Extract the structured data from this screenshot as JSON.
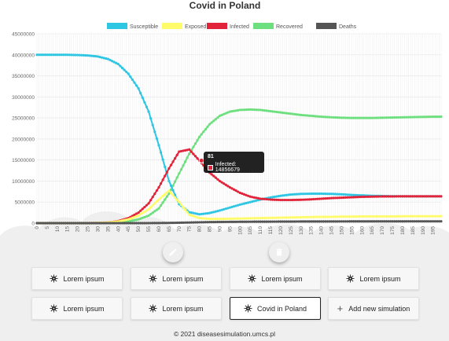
{
  "colors": {
    "susceptible": "#2ec6e3",
    "exposed": "#fffb6a",
    "infected": "#e2243b",
    "recovered": "#6ddf7e",
    "deaths": "#555555",
    "edit_fab": "#3f51b5",
    "delete_fab": "#f44336"
  },
  "chart_data": {
    "type": "line",
    "title": "Covid in Poland",
    "x": [
      0,
      5,
      10,
      15,
      20,
      25,
      30,
      35,
      40,
      45,
      50,
      55,
      60,
      65,
      70,
      75,
      80,
      85,
      90,
      95,
      100,
      105,
      110,
      115,
      120,
      125,
      130,
      135,
      140,
      145,
      150,
      155,
      160,
      165,
      170,
      175,
      180,
      185,
      190,
      195
    ],
    "x_ticks": [
      "0",
      "5",
      "10",
      "15",
      "20",
      "25",
      "30",
      "35",
      "40",
      "45",
      "50",
      "55",
      "60",
      "65",
      "70",
      "75",
      "80",
      "85",
      "90",
      "95",
      "100",
      "105",
      "110",
      "115",
      "120",
      "125",
      "130",
      "135",
      "140",
      "145",
      "150",
      "155",
      "160",
      "165",
      "170",
      "175",
      "180",
      "185",
      "190",
      "195"
    ],
    "y_ticks": [
      "0",
      "5000000",
      "10000000",
      "15000000",
      "20000000",
      "25000000",
      "30000000",
      "35000000",
      "40000000",
      "45000000"
    ],
    "ylim": [
      0,
      45000000
    ],
    "xlim": [
      0,
      199
    ],
    "grid": true,
    "legend_position": "top",
    "series": [
      {
        "name": "Susceptible",
        "color_key": "susceptible",
        "values": [
          40000000,
          40000000,
          40000000,
          40000000,
          39950000,
          39850000,
          39600000,
          39000000,
          37800000,
          35500000,
          32000000,
          26500000,
          18500000,
          10000000,
          4500000,
          2600000,
          2100000,
          2400000,
          3000000,
          3700000,
          4400000,
          5000000,
          5600000,
          6100000,
          6500000,
          6800000,
          6950000,
          7000000,
          7000000,
          6950000,
          6850000,
          6700000,
          6600000,
          6500000,
          6450000,
          6400000,
          6380000,
          6370000,
          6370000,
          6370000
        ]
      },
      {
        "name": "Exposed",
        "color_key": "exposed",
        "values": [
          0,
          0,
          0,
          0,
          0,
          0,
          50000,
          150000,
          400000,
          900000,
          1800000,
          3300000,
          5600000,
          7700000,
          5000000,
          2000000,
          1200000,
          1000000,
          1000000,
          1050000,
          1100000,
          1150000,
          1200000,
          1250000,
          1300000,
          1350000,
          1400000,
          1450000,
          1500000,
          1500000,
          1550000,
          1550000,
          1600000,
          1600000,
          1600000,
          1600000,
          1650000,
          1650000,
          1650000,
          1650000
        ]
      },
      {
        "name": "Infected",
        "color_key": "infected",
        "values": [
          0,
          0,
          0,
          0,
          0,
          0,
          50000,
          150000,
          500000,
          1200000,
          2500000,
          4700000,
          8500000,
          13000000,
          17000000,
          17500000,
          14856679,
          12000000,
          10000000,
          8500000,
          7200000,
          6300000,
          5800000,
          5600000,
          5500000,
          5500000,
          5550000,
          5650000,
          5800000,
          5950000,
          6050000,
          6150000,
          6250000,
          6300000,
          6350000,
          6350000,
          6380000,
          6380000,
          6380000,
          6380000
        ]
      },
      {
        "name": "Recovered",
        "color_key": "recovered",
        "values": [
          0,
          0,
          0,
          0,
          0,
          0,
          0,
          50000,
          150000,
          400000,
          900000,
          1800000,
          3500000,
          7000000,
          11800000,
          16500000,
          20500000,
          23500000,
          25500000,
          26500000,
          26900000,
          27000000,
          26900000,
          26600000,
          26300000,
          26000000,
          25700000,
          25500000,
          25300000,
          25150000,
          25050000,
          25000000,
          25000000,
          25000000,
          25050000,
          25100000,
          25150000,
          25200000,
          25250000,
          25300000
        ]
      },
      {
        "name": "Deaths",
        "color_key": "deaths",
        "values": [
          0,
          0,
          0,
          0,
          0,
          0,
          0,
          0,
          0,
          0,
          0,
          10000,
          30000,
          60000,
          100000,
          150000,
          200000,
          250000,
          280000,
          300000,
          320000,
          340000,
          350000,
          360000,
          370000,
          380000,
          390000,
          395000,
          400000,
          405000,
          410000,
          415000,
          420000,
          425000,
          430000,
          430000,
          430000,
          435000,
          435000,
          435000
        ]
      }
    ],
    "tooltip": {
      "title": "81",
      "label": "Infected: 14856679",
      "series": "Infected"
    }
  },
  "buttons": [
    {
      "label": "Lorem ipsum",
      "icon": "virus-icon",
      "active": false
    },
    {
      "label": "Lorem ipsum",
      "icon": "virus-icon",
      "active": false
    },
    {
      "label": "Lorem ipsum",
      "icon": "virus-icon",
      "active": false
    },
    {
      "label": "Lorem ipsum",
      "icon": "virus-icon",
      "active": false
    },
    {
      "label": "Lorem ipsum",
      "icon": "virus-icon",
      "active": false
    },
    {
      "label": "Lorem ipsum",
      "icon": "virus-icon",
      "active": false
    },
    {
      "label": "Covid in Poland",
      "icon": "virus-icon",
      "active": true
    },
    {
      "label": "Add new simulation",
      "icon": "plus-icon",
      "active": false
    }
  ],
  "footer": "© 2021 diseasesimulation.umcs.pl"
}
